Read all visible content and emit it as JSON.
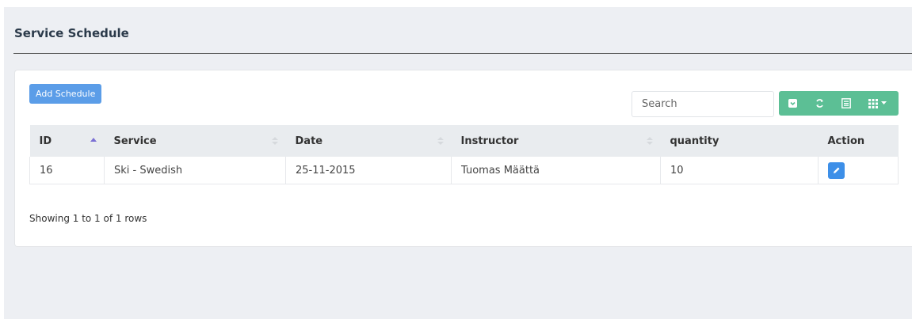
{
  "page": {
    "title": "Service Schedule"
  },
  "actions": {
    "add_label": "Add Schedule"
  },
  "search": {
    "placeholder": "Search"
  },
  "toolbar": {
    "buttons": [
      {
        "icon": "export-icon"
      },
      {
        "icon": "refresh-icon"
      },
      {
        "icon": "toggle-view-icon"
      },
      {
        "icon": "columns-icon"
      }
    ],
    "color": "#5cbf95"
  },
  "table": {
    "columns": [
      "ID",
      "Service",
      "Date",
      "Instructor",
      "quantity",
      "Action"
    ],
    "rows": [
      {
        "id": "16",
        "service": "Ski - Swedish",
        "date": "25-11-2015",
        "instructor": "Tuomas Määttä",
        "quantity": "10"
      }
    ]
  },
  "pagination": {
    "info": "Showing 1 to 1 of 1 rows"
  },
  "colors": {
    "primary": "#5b9de8",
    "success": "#5cbf95",
    "edit": "#3d8fe8",
    "background": "#edeff3"
  }
}
